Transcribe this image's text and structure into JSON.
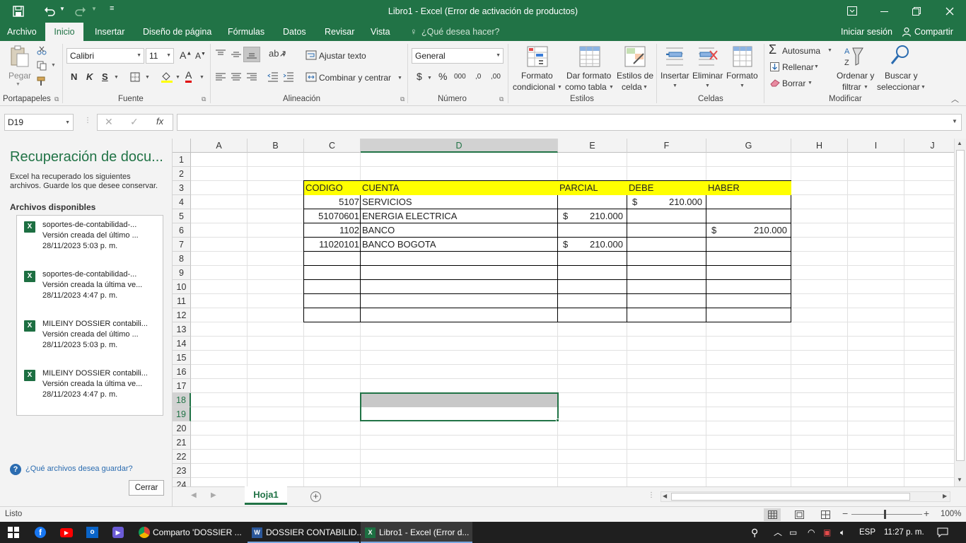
{
  "window": {
    "title": "Libro1 - Excel (Error de activación de productos)"
  },
  "menu": {
    "items": [
      "Archivo",
      "Inicio",
      "Insertar",
      "Diseño de página",
      "Fórmulas",
      "Datos",
      "Revisar",
      "Vista"
    ],
    "tell_me": "¿Qué desea hacer?",
    "signin": "Iniciar sesión",
    "share": "Compartir"
  },
  "ribbon": {
    "paste": "Pegar",
    "font_name": "Calibri",
    "font_size": "11",
    "bold": "N",
    "italic": "K",
    "underline": "S",
    "wrap_text": "Ajustar texto",
    "merge_center": "Combinar y centrar",
    "number_format": "General",
    "currency": "$",
    "percent": "%",
    "thousands": "000",
    "dec_inc": ",0",
    "dec_dec": ",00",
    "cond_format_1": "Formato",
    "cond_format_2": "condicional",
    "format_table_1": "Dar formato",
    "format_table_2": "como tabla",
    "cell_styles_1": "Estilos de",
    "cell_styles_2": "celda",
    "insert": "Insertar",
    "delete": "Eliminar",
    "format": "Formato",
    "autosum": "Autosuma",
    "fill": "Rellenar",
    "clear": "Borrar",
    "sort_1": "Ordenar y",
    "sort_2": "filtrar",
    "find_1": "Buscar y",
    "find_2": "seleccionar",
    "groups": {
      "clipboard": "Portapapeles",
      "font": "Fuente",
      "alignment": "Alineación",
      "number": "Número",
      "styles": "Estilos",
      "cells": "Celdas",
      "editing": "Modificar"
    }
  },
  "formula_bar": {
    "name_box": "D19",
    "fx": "fx",
    "value": ""
  },
  "recovery": {
    "title": "Recuperación de docu...",
    "desc_1": "Excel ha recuperado los siguientes",
    "desc_2": "archivos. Guarde los que desee conservar.",
    "available": "Archivos disponibles",
    "files": [
      {
        "name": "soportes-de-contabilidad-...",
        "version": "Versión creada del último ...",
        "date": "28/11/2023 5:03 p. m."
      },
      {
        "name": "soportes-de-contabilidad-...",
        "version": "Versión creada la última ve...",
        "date": "28/11/2023 4:47 p. m."
      },
      {
        "name": "MILEINY DOSSIER contabili...",
        "version": "Versión creada del último ...",
        "date": "28/11/2023 5:03 p. m."
      },
      {
        "name": "MILEINY DOSSIER contabili...",
        "version": "Versión creada la última ve...",
        "date": "28/11/2023 4:47 p. m."
      }
    ],
    "which_files": "¿Qué archivos desea guardar?",
    "close": "Cerrar"
  },
  "sheet": {
    "columns": [
      "A",
      "B",
      "C",
      "D",
      "E",
      "F",
      "G",
      "H",
      "I",
      "J"
    ],
    "rows": [
      "1",
      "2",
      "3",
      "4",
      "5",
      "6",
      "7",
      "8",
      "9",
      "10",
      "11",
      "12",
      "13",
      "14",
      "15",
      "16",
      "17",
      "18",
      "19",
      "20",
      "21",
      "22",
      "23",
      "24"
    ],
    "headers": {
      "codigo": "CODIGO",
      "cuenta": "CUENTA",
      "parcial": "PARCIAL",
      "debe": "DEBE",
      "haber": "HABER"
    },
    "data": [
      {
        "codigo": "5107",
        "cuenta": "SERVICIOS",
        "parcial": "",
        "debe": "210.000",
        "haber": ""
      },
      {
        "codigo": "51070601",
        "cuenta": "ENERGIA ELECTRICA",
        "parcial": "210.000",
        "debe": "",
        "haber": ""
      },
      {
        "codigo": "1102",
        "cuenta": "BANCO",
        "parcial": "",
        "debe": "",
        "haber": "210.000"
      },
      {
        "codigo": "11020101",
        "cuenta": "BANCO BOGOTA",
        "parcial": "210.000",
        "debe": "",
        "haber": ""
      }
    ],
    "currency_symbol": "$",
    "tab": "Hoja1"
  },
  "status": {
    "ready": "Listo",
    "zoom": "100%"
  },
  "taskbar": {
    "items": [
      "Comparto 'DOSSIER ...",
      "DOSSIER CONTABILID...",
      "Libro1 - Excel (Error d..."
    ],
    "lang": "ESP",
    "time": "11:27 p. m."
  },
  "colors": {
    "excel_green": "#217346",
    "header_yellow": "#ffff00",
    "selection_gray": "#c8c8c8"
  }
}
